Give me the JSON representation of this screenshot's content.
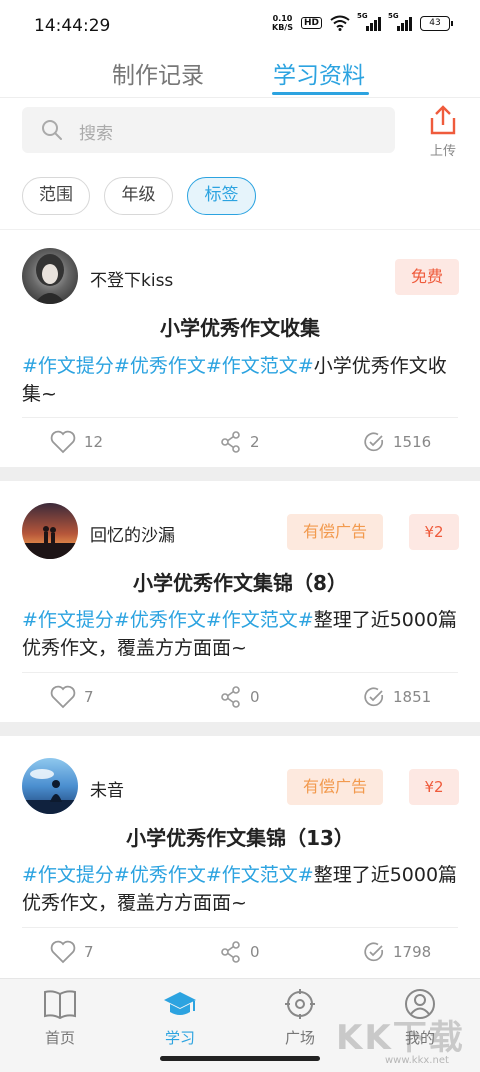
{
  "status_bar": {
    "time": "14:44:29",
    "net_speed_value": "0.10",
    "net_speed_unit": "KB/S",
    "hd_label": "HD",
    "sig1_label": "5G",
    "sig2_label": "5G",
    "battery": "43"
  },
  "tabs": [
    {
      "label": "制作记录",
      "active": false
    },
    {
      "label": "学习资料",
      "active": true
    }
  ],
  "search": {
    "placeholder": "搜索",
    "icon": "search-icon"
  },
  "upload": {
    "label": "上传",
    "icon": "upload-icon",
    "color": "#ef5b3c"
  },
  "filters": [
    {
      "label": "范围",
      "active": false
    },
    {
      "label": "年级",
      "active": false
    },
    {
      "label": "标签",
      "active": true
    }
  ],
  "posts": [
    {
      "author": "不登下kiss",
      "badges": [
        {
          "type": "free",
          "label": "免费"
        }
      ],
      "title": "小学优秀作文收集",
      "hashtags": "#作文提分#优秀作文#作文范文#",
      "desc_rest": "小学优秀作文收集~",
      "likes": "12",
      "shares": "2",
      "views": "1516"
    },
    {
      "author": "回忆的沙漏",
      "badges": [
        {
          "type": "ad",
          "label": "有偿广告"
        },
        {
          "type": "price",
          "label": "¥2"
        }
      ],
      "title": "小学优秀作文集锦（8）",
      "hashtags": "#作文提分#优秀作文#作文范文#",
      "desc_rest": "整理了近5000篇优秀作文，覆盖方方面面~",
      "likes": "7",
      "shares": "0",
      "views": "1851"
    },
    {
      "author": "未音",
      "badges": [
        {
          "type": "ad",
          "label": "有偿广告"
        },
        {
          "type": "price",
          "label": "¥2"
        }
      ],
      "title": "小学优秀作文集锦（13）",
      "hashtags": "#作文提分#优秀作文#作文范文#",
      "desc_rest": "整理了近5000篇优秀作文，覆盖方方面面~",
      "likes": "7",
      "shares": "0",
      "views": "1798"
    }
  ],
  "bottom_nav": [
    {
      "label": "首页",
      "icon": "book-icon",
      "active": false
    },
    {
      "label": "学习",
      "icon": "graduation-cap-icon",
      "active": true
    },
    {
      "label": "广场",
      "icon": "target-icon",
      "active": false
    },
    {
      "label": "我的",
      "icon": "user-icon",
      "active": false
    }
  ],
  "watermark": {
    "text": "KK下载",
    "url": "www.kkx.net"
  },
  "colors": {
    "accent": "#2ca3e0",
    "free_badge": "#ef5b3c",
    "ad_badge": "#f29a4e"
  }
}
